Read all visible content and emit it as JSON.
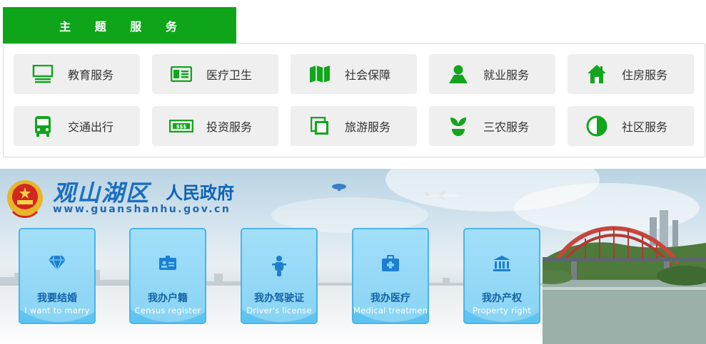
{
  "theme_services": {
    "title": "主 题 服 务",
    "accent": "#0fa51a",
    "items": [
      {
        "label": "教育服务",
        "icon": "blackboard-icon"
      },
      {
        "label": "医疗卫生",
        "icon": "medical-card-icon"
      },
      {
        "label": "社会保障",
        "icon": "map-icon"
      },
      {
        "label": "就业服务",
        "icon": "person-icon"
      },
      {
        "label": "住房服务",
        "icon": "house-icon"
      },
      {
        "label": "交通出行",
        "icon": "bus-icon"
      },
      {
        "label": "投资服务",
        "icon": "banknote-icon"
      },
      {
        "label": "旅游服务",
        "icon": "photo-stack-icon"
      },
      {
        "label": "三农服务",
        "icon": "sprout-icon"
      },
      {
        "label": "社区服务",
        "icon": "half-circle-icon"
      }
    ]
  },
  "banner": {
    "title": "观山湖区",
    "subtitle": "人民政府",
    "url": "www.guanshanhu.gov.cn",
    "cards": [
      {
        "cn": "我要结婚",
        "en": "I want to marry",
        "icon": "diamond-icon"
      },
      {
        "cn": "我办户籍",
        "en": "Census register",
        "icon": "id-card-icon"
      },
      {
        "cn": "我办驾驶证",
        "en": "Driver's license",
        "icon": "motorcycle-icon"
      },
      {
        "cn": "我办医疗",
        "en": "Medical treatment",
        "icon": "first-aid-kit-icon"
      },
      {
        "cn": "我办产权",
        "en": "Property right",
        "icon": "bank-building-icon"
      }
    ]
  }
}
